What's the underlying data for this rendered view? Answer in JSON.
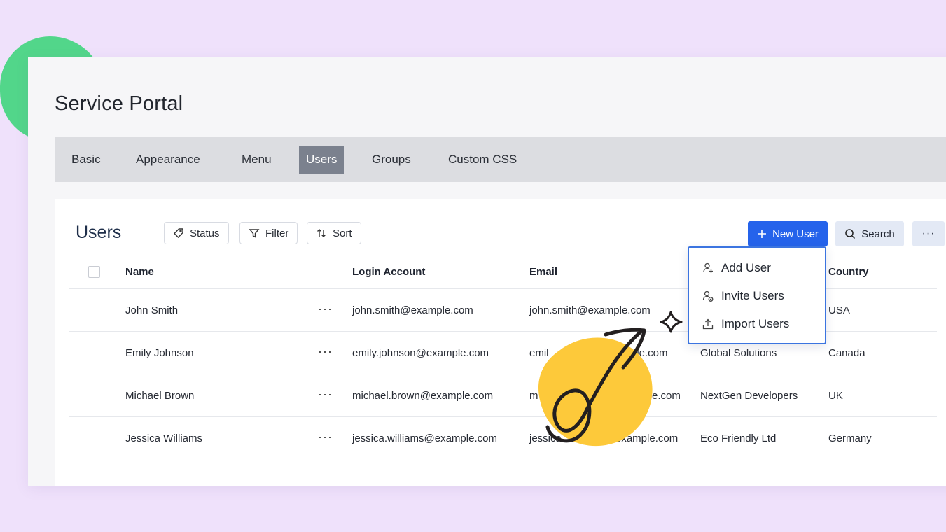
{
  "app": {
    "title": "Service Portal"
  },
  "tabs": [
    {
      "label": "Basic",
      "active": false
    },
    {
      "label": "Appearance",
      "active": false
    },
    {
      "label": "Menu",
      "active": false
    },
    {
      "label": "Users",
      "active": true
    },
    {
      "label": "Groups",
      "active": false
    },
    {
      "label": "Custom CSS",
      "active": false
    }
  ],
  "section": {
    "title": "Users"
  },
  "toolbar": {
    "status_label": "Status",
    "filter_label": "Filter",
    "sort_label": "Sort",
    "new_user_label": "New User",
    "search_label": "Search",
    "more_label": "···"
  },
  "table": {
    "columns": [
      "Name",
      "Login Account",
      "Email",
      "Country"
    ],
    "rows": [
      {
        "name": "John Smith",
        "login": "john.smith@example.com",
        "email": "john.smith@example.com",
        "company": "",
        "country": "USA"
      },
      {
        "name": "Emily Johnson",
        "login": "emily.johnson@example.com",
        "email_left": "emil",
        "email_right": "ple.com",
        "company": "Global Solutions",
        "country": "Canada"
      },
      {
        "name": "Michael Brown",
        "login": "michael.brown@example.com",
        "email_left": "m",
        "email_right": "e.com",
        "company": "NextGen Developers",
        "country": "UK"
      },
      {
        "name": "Jessica Williams",
        "login": "jessica.williams@example.com",
        "email_left": "jessica",
        "email_right": "example.com",
        "company": "Eco Friendly Ltd",
        "country": "Germany"
      }
    ],
    "row_actions_label": "···"
  },
  "dropdown": {
    "items": [
      {
        "label": "Add User",
        "icon": "user-add-icon"
      },
      {
        "label": "Invite Users",
        "icon": "user-invite-icon"
      },
      {
        "label": "Import Users",
        "icon": "upload-icon"
      }
    ]
  },
  "colors": {
    "background": "#efe1fb",
    "accent": "#2563eb",
    "active_tab": "#7b818e",
    "menu_border": "#3b74e0",
    "yellow_blob": "#fdc93a",
    "green_blob": "#52d68a"
  }
}
